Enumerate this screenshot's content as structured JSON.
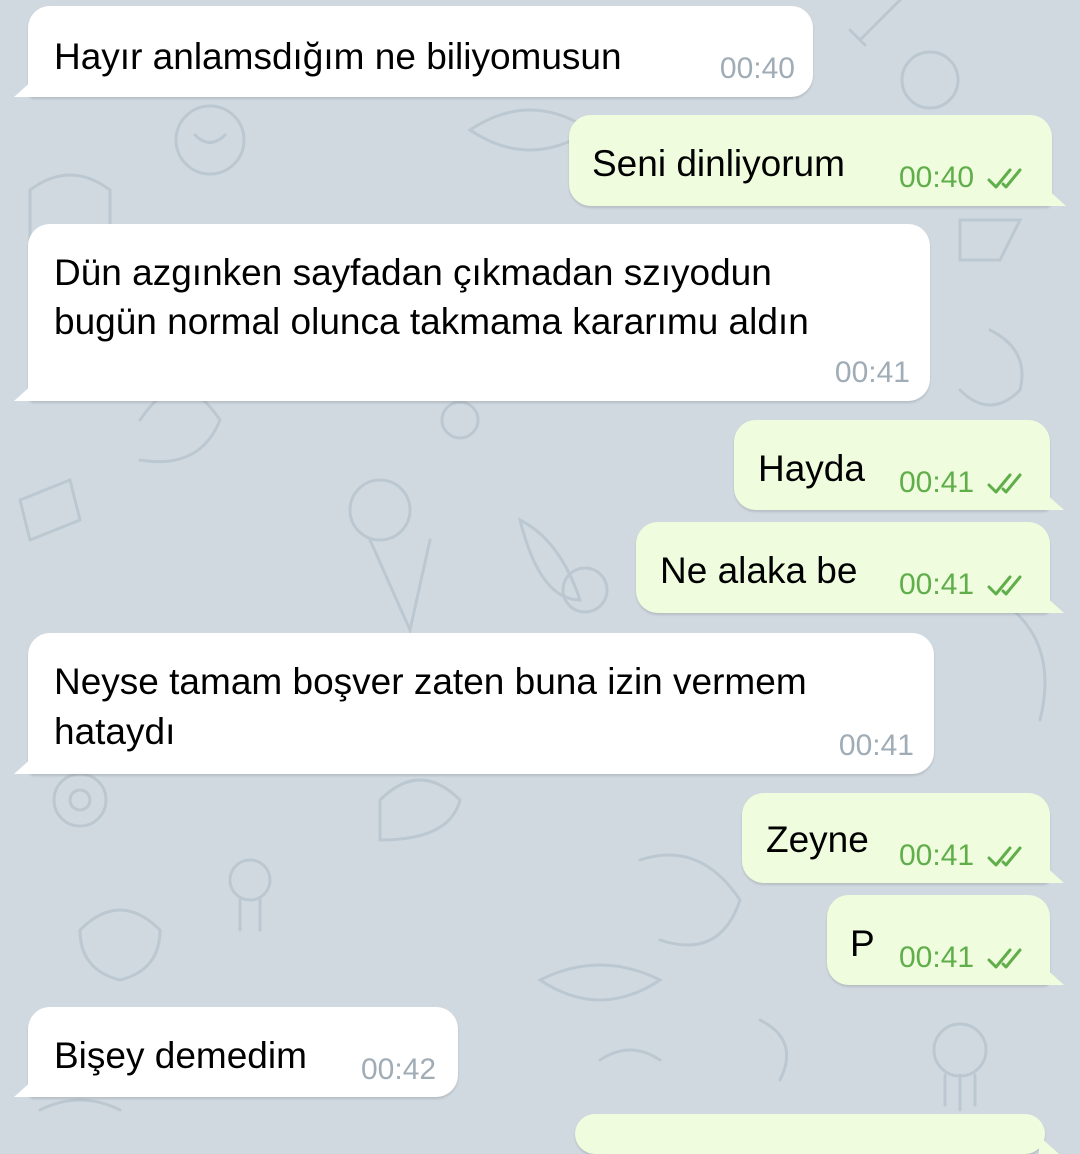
{
  "colors": {
    "background": "#d0d9e0",
    "incoming_bubble": "#ffffff",
    "outgoing_bubble": "#effdde",
    "incoming_time": "#a0acb6",
    "outgoing_time": "#5fae4a",
    "read_check": "#5fae4a"
  },
  "messages": [
    {
      "direction": "incoming",
      "lines": [
        "Hayır anlamsdığım ne biliyomusun"
      ],
      "time": "00:40"
    },
    {
      "direction": "outgoing",
      "lines": [
        "Seni dinliyorum"
      ],
      "time": "00:40",
      "status_icon": "double-check-icon"
    },
    {
      "direction": "incoming",
      "lines": [
        "Dün azgınken sayfadan çıkmadan szıyodun",
        "bugün normal olunca takmama kararımu aldın"
      ],
      "time": "00:41"
    },
    {
      "direction": "outgoing",
      "lines": [
        "Hayda"
      ],
      "time": "00:41",
      "status_icon": "double-check-icon"
    },
    {
      "direction": "outgoing",
      "lines": [
        "Ne alaka be"
      ],
      "time": "00:41",
      "status_icon": "double-check-icon"
    },
    {
      "direction": "incoming",
      "lines": [
        "Neyse tamam boşver zaten buna izin vermem",
        "hataydı"
      ],
      "time": "00:41"
    },
    {
      "direction": "outgoing",
      "lines": [
        "Zeyne"
      ],
      "time": "00:41",
      "status_icon": "double-check-icon"
    },
    {
      "direction": "outgoing",
      "lines": [
        "P"
      ],
      "time": "00:41",
      "status_icon": "double-check-icon"
    },
    {
      "direction": "incoming",
      "lines": [
        "Bişey demedim"
      ],
      "time": "00:42"
    }
  ]
}
